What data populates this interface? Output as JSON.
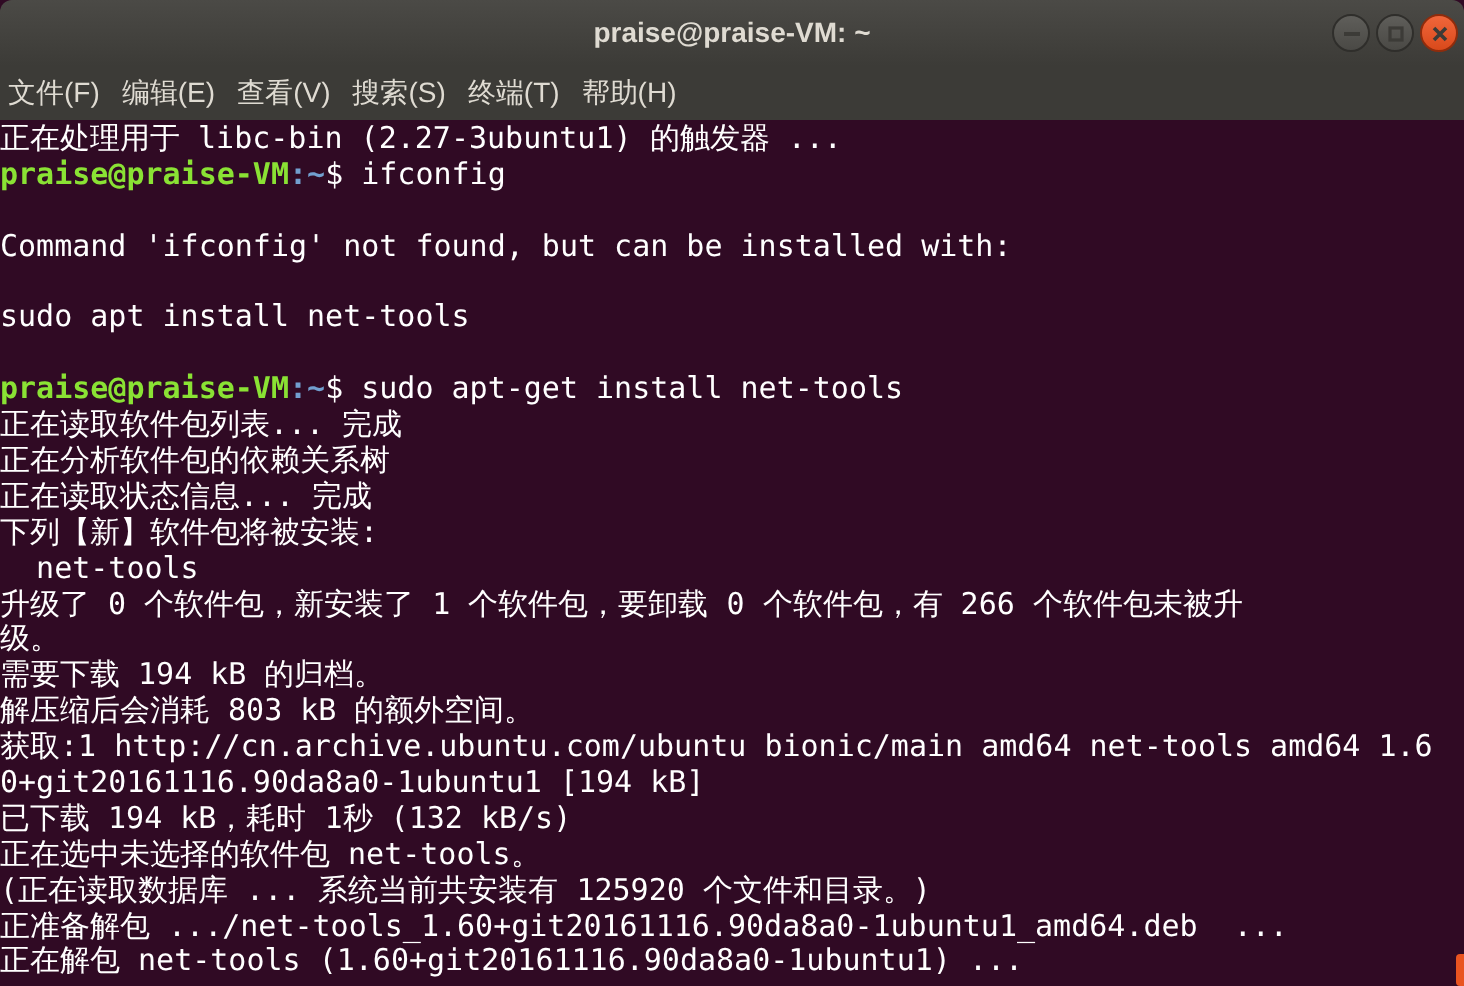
{
  "window": {
    "title": "praise@praise-VM: ~"
  },
  "menu": [
    "文件(F)",
    "编辑(E)",
    "查看(V)",
    "搜索(S)",
    "终端(T)",
    "帮助(H)"
  ],
  "lines": [
    {
      "kind": "output",
      "text": "正在处理用于 libc-bin (2.27-3ubuntu1) 的触发器 ..."
    },
    {
      "kind": "prompt",
      "user": "praise@praise-VM",
      "path": ":~",
      "command": "$ ifconfig"
    },
    {
      "kind": "blank"
    },
    {
      "kind": "output",
      "text": "Command 'ifconfig' not found, but can be installed with:"
    },
    {
      "kind": "blank"
    },
    {
      "kind": "output",
      "text": "sudo apt install net-tools"
    },
    {
      "kind": "blank"
    },
    {
      "kind": "prompt",
      "user": "praise@praise-VM",
      "path": ":~",
      "command": "$ sudo apt-get install net-tools"
    },
    {
      "kind": "output",
      "text": "正在读取软件包列表... 完成"
    },
    {
      "kind": "output",
      "text": "正在分析软件包的依赖关系树"
    },
    {
      "kind": "output",
      "text": "正在读取状态信息... 完成"
    },
    {
      "kind": "output",
      "text": "下列【新】软件包将被安装:"
    },
    {
      "kind": "output",
      "text": "  net-tools"
    },
    {
      "kind": "output",
      "text": "升级了 0 个软件包，新安装了 1 个软件包，要卸载 0 个软件包，有 266 个软件包未被升"
    },
    {
      "kind": "output",
      "text": "级。"
    },
    {
      "kind": "output",
      "text": "需要下载 194 kB 的归档。"
    },
    {
      "kind": "output",
      "text": "解压缩后会消耗 803 kB 的额外空间。"
    },
    {
      "kind": "output",
      "text": "获取:1 http://cn.archive.ubuntu.com/ubuntu bionic/main amd64 net-tools amd64 1.6"
    },
    {
      "kind": "output",
      "text": "0+git20161116.90da8a0-1ubuntu1 [194 kB]"
    },
    {
      "kind": "output",
      "text": "已下载 194 kB，耗时 1秒 (132 kB/s)"
    },
    {
      "kind": "output",
      "text": "正在选中未选择的软件包 net-tools。"
    },
    {
      "kind": "output",
      "text": "(正在读取数据库 ... 系统当前共安装有 125920 个文件和目录。)"
    },
    {
      "kind": "output",
      "text": "正准备解包 .../net-tools_1.60+git20161116.90da8a0-1ubuntu1_amd64.deb  ..."
    },
    {
      "kind": "output",
      "text": "正在解包 net-tools (1.60+git20161116.90da8a0-1ubuntu1) ..."
    }
  ]
}
